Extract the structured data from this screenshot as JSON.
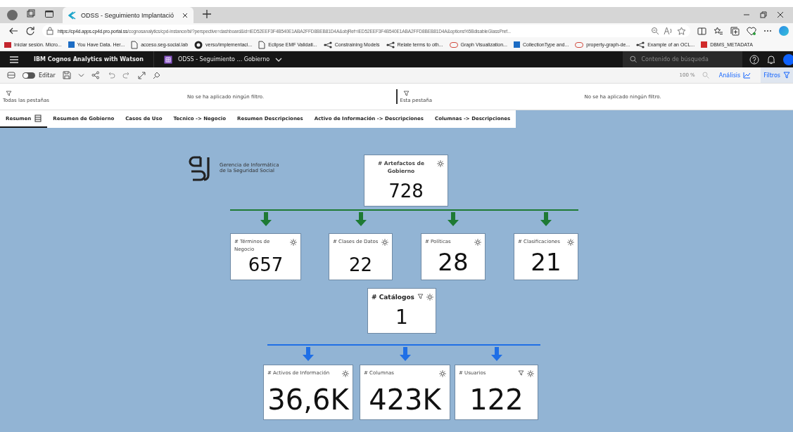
{
  "browser": {
    "tab_title": "ODSS - Seguimiento Implantació",
    "url_host": "https://cp4d.apps.cp4d.pro.portal.ss",
    "url_rest": "/cognosanalytics/cpd-instance/bi/?perspective=dashboard&id=iED52EEF3F4B540E1ABA2FFD8BEB81D4A&objRef=iED52EEF3F4B540E1ABA2FFD8BEB81D4A&options%5BdisableGlassPref...",
    "bookmarks": [
      {
        "label": "Iniciar sesión. Micro...",
        "kind": "m"
      },
      {
        "label": "You Have Data. Her...",
        "kind": "square"
      },
      {
        "label": "acceso.seg-social.lab",
        "kind": "page"
      },
      {
        "label": "verso/implementaci...",
        "kind": "github"
      },
      {
        "label": "Eclipse EMF Validati...",
        "kind": "page"
      },
      {
        "label": "Constraining Models",
        "kind": "graph"
      },
      {
        "label": "Relate terms to oth...",
        "kind": "graph"
      },
      {
        "label": "Graph Visualization...",
        "kind": "oracle"
      },
      {
        "label": "CollectionType and...",
        "kind": "square"
      },
      {
        "label": "property-graph-de...",
        "kind": "oracle"
      },
      {
        "label": "Example of an OCL...",
        "kind": "graph"
      },
      {
        "label": "DBMS_METADATA",
        "kind": "red"
      }
    ]
  },
  "app": {
    "product": "IBM Cognos Analytics with Watson",
    "dashboard": "ODSS - Seguimiento ... Gobierno",
    "search": {
      "placeholder": "Contenido de búsqueda"
    }
  },
  "toolbar": {
    "edit_label": "Editar",
    "edit_on": false,
    "zoom": "100 %",
    "analysis": "Análisis",
    "filters": "Filtros"
  },
  "filters": [
    {
      "label": "Todas las pestañas",
      "message": "No se ha aplicado ningún filtro."
    },
    {
      "label": "Esta pestaña",
      "message": "No se ha aplicado ningún filtro."
    }
  ],
  "tabs": [
    {
      "label": "Resumen",
      "selected": true
    },
    {
      "label": "Resumen de Gobierno",
      "selected": false
    },
    {
      "label": "Casos de Uso",
      "selected": false
    },
    {
      "label": "Tecnico -> Negocio",
      "selected": false
    },
    {
      "label": "Resumen Descripciones",
      "selected": false
    },
    {
      "label": "Activo de Información -> Descripciones",
      "selected": false
    },
    {
      "label": "Columnas -> Descripciones",
      "selected": false
    }
  ],
  "logo": {
    "line1": "Gerencia de Informática",
    "line2": "de la Seguridad Social"
  },
  "groups": [
    {
      "color": "#1e7a34",
      "parent": {
        "title": "# Artefactos de Gobierno",
        "value": "728",
        "filter": false
      },
      "children": [
        {
          "title": "# Términos de Negocio",
          "value": "657",
          "filter": false
        },
        {
          "title": "# Clases de Datos",
          "value": "22",
          "filter": false
        },
        {
          "title": "# Políticas",
          "value": "28",
          "filter": false
        },
        {
          "title": "# Clasificaciones",
          "value": "21",
          "filter": false
        }
      ]
    },
    {
      "color": "#1f6fe6",
      "parent": {
        "title": "# Catálogos",
        "value": "1",
        "filter": true
      },
      "children": [
        {
          "title": "# Activos de Información",
          "value": "36,6K",
          "filter": false
        },
        {
          "title": "# Columnas",
          "value": "423K",
          "filter": false
        },
        {
          "title": "# Usuarios",
          "value": "122",
          "filter": true
        }
      ]
    }
  ]
}
